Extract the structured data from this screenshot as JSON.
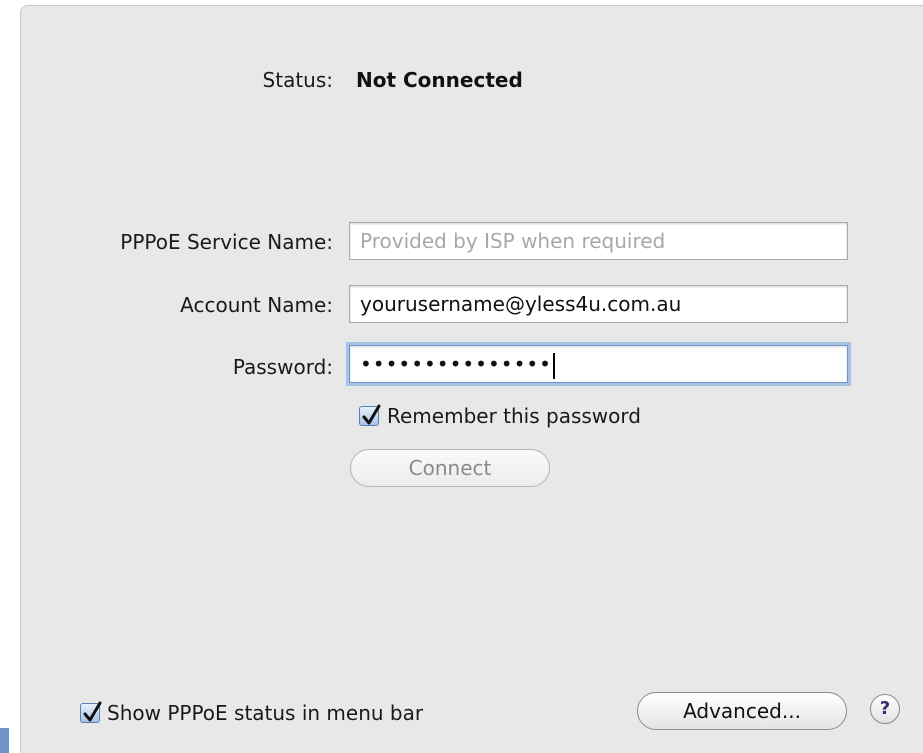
{
  "status": {
    "label": "Status:",
    "value": "Not Connected"
  },
  "form": {
    "service_name": {
      "label": "PPPoE Service Name:",
      "value": "",
      "placeholder": "Provided by ISP when required"
    },
    "account_name": {
      "label": "Account Name:",
      "value": "yourusername@yless4u.com.au"
    },
    "password": {
      "label": "Password:",
      "masked_value": "•••••••••••••••"
    },
    "remember_password": {
      "label": "Remember this password",
      "checked": true
    },
    "connect_label": "Connect"
  },
  "footer": {
    "show_status_label": "Show PPPoE status in menu bar",
    "show_status_checked": true,
    "advanced_label": "Advanced...",
    "help_label": "?"
  },
  "colors": {
    "panel_bg": "#e8e8e8",
    "focus_ring": "#a8c2e6",
    "checkbox_accent": "#5c7fb3"
  }
}
